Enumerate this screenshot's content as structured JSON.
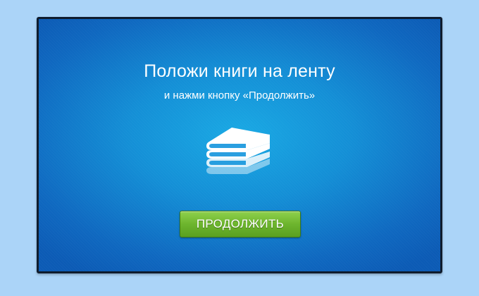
{
  "screen": {
    "title": "Положи книги на ленту",
    "subtitle": "и нажми кнопку «Продолжить»",
    "icon": "stack-of-books-icon",
    "continue_label": "ПРОДОЛЖИТЬ"
  },
  "colors": {
    "page_background": "#abd4f8",
    "screen_center": "#1aa9e4",
    "screen_edge": "#0c5bb5",
    "button_green": "#6db52e",
    "text": "#ffffff"
  }
}
